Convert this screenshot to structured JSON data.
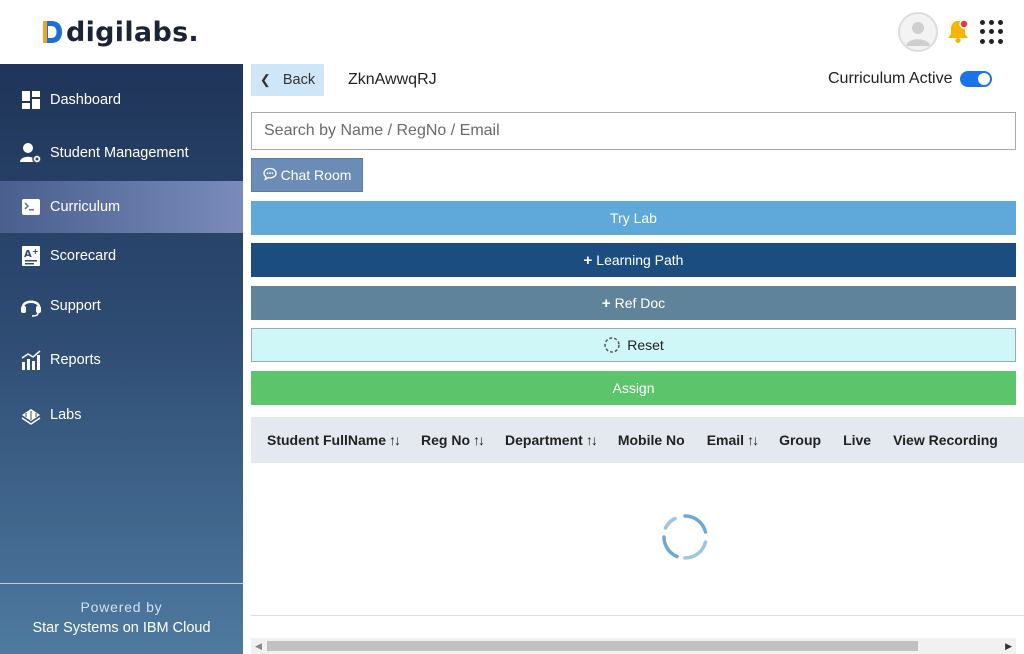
{
  "brand": {
    "name": "digilabs.",
    "accent": "#1c6fd6"
  },
  "header": {
    "avatar_icon": "user-avatar-icon",
    "bell_icon": "bell-icon",
    "apps_icon": "grid-apps-icon"
  },
  "sidebar": {
    "items": [
      {
        "label": "Dashboard",
        "icon": "dashboard-icon"
      },
      {
        "label": "Student Management",
        "icon": "student-management-icon"
      },
      {
        "label": "Curriculum",
        "icon": "curriculum-icon",
        "active": true
      },
      {
        "label": "Scorecard",
        "icon": "scorecard-icon"
      },
      {
        "label": "Support",
        "icon": "headset-icon"
      },
      {
        "label": "Reports",
        "icon": "reports-icon"
      },
      {
        "label": "Labs",
        "icon": "labs-icon"
      }
    ],
    "footer": {
      "powered_by": "Powered by",
      "company": "Star Systems on IBM Cloud"
    }
  },
  "main": {
    "back_label": "Back",
    "curriculum_name": "ZknAwwqRJ",
    "active_label": "Curriculum Active",
    "active_toggle": true,
    "search_placeholder": "Search by Name / RegNo / Email",
    "chat_label": "Chat Room",
    "buttons": {
      "try_lab": "Try Lab",
      "learning_path": "Learning Path",
      "ref_doc": "Ref Doc",
      "reset": "Reset",
      "assign": "Assign"
    },
    "table": {
      "columns": [
        {
          "label": "Student FullName",
          "sortable": true
        },
        {
          "label": "Reg No",
          "sortable": true
        },
        {
          "label": "Department",
          "sortable": true
        },
        {
          "label": "Mobile No",
          "sortable": false
        },
        {
          "label": "Email",
          "sortable": true
        },
        {
          "label": "Group",
          "sortable": false
        },
        {
          "label": "Live",
          "sortable": false
        },
        {
          "label": "View Recording",
          "sortable": false
        }
      ],
      "loading": true
    }
  }
}
